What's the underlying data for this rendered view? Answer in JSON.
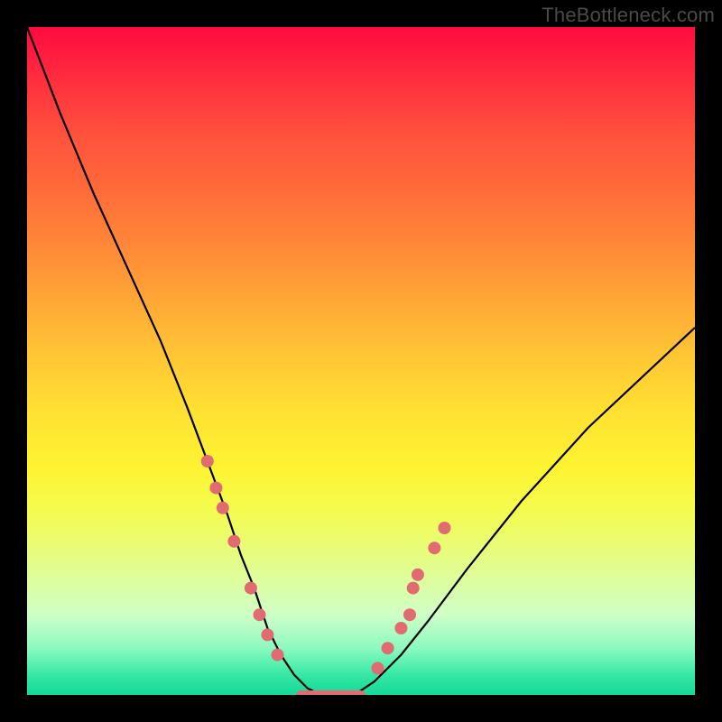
{
  "watermark": "TheBottleneck.com",
  "chart_data": {
    "type": "line",
    "title": "",
    "xlabel": "",
    "ylabel": "",
    "xlim": [
      0,
      100
    ],
    "ylim": [
      0,
      100
    ],
    "grid": false,
    "legend": false,
    "series": [
      {
        "name": "bottleneck-curve",
        "x": [
          0,
          5,
          10,
          15,
          20,
          24,
          27,
          30,
          32,
          34,
          36,
          38,
          40,
          42,
          44,
          46,
          49,
          52,
          56,
          60,
          66,
          74,
          84,
          100
        ],
        "y": [
          100,
          87,
          75,
          64,
          53,
          43,
          35,
          27,
          21,
          16,
          10,
          6,
          3,
          1,
          0,
          0,
          0,
          2,
          6,
          11,
          19,
          29,
          40,
          55
        ]
      }
    ],
    "flat_segment": {
      "x_start": 41,
      "x_end": 50,
      "y": 0
    },
    "dots_left": [
      {
        "x": 27.0,
        "y": 35
      },
      {
        "x": 28.3,
        "y": 31
      },
      {
        "x": 29.3,
        "y": 28
      },
      {
        "x": 31.0,
        "y": 23
      },
      {
        "x": 33.5,
        "y": 16
      },
      {
        "x": 34.8,
        "y": 12
      },
      {
        "x": 36.0,
        "y": 9
      },
      {
        "x": 37.5,
        "y": 6
      }
    ],
    "dots_right": [
      {
        "x": 52.5,
        "y": 4
      },
      {
        "x": 54.0,
        "y": 7
      },
      {
        "x": 56.0,
        "y": 10
      },
      {
        "x": 57.3,
        "y": 12
      },
      {
        "x": 57.8,
        "y": 16
      },
      {
        "x": 58.5,
        "y": 18
      },
      {
        "x": 61.0,
        "y": 22
      },
      {
        "x": 62.5,
        "y": 25
      }
    ],
    "background_gradient_desc": "vertical red-orange-yellow-green heat gradient"
  }
}
